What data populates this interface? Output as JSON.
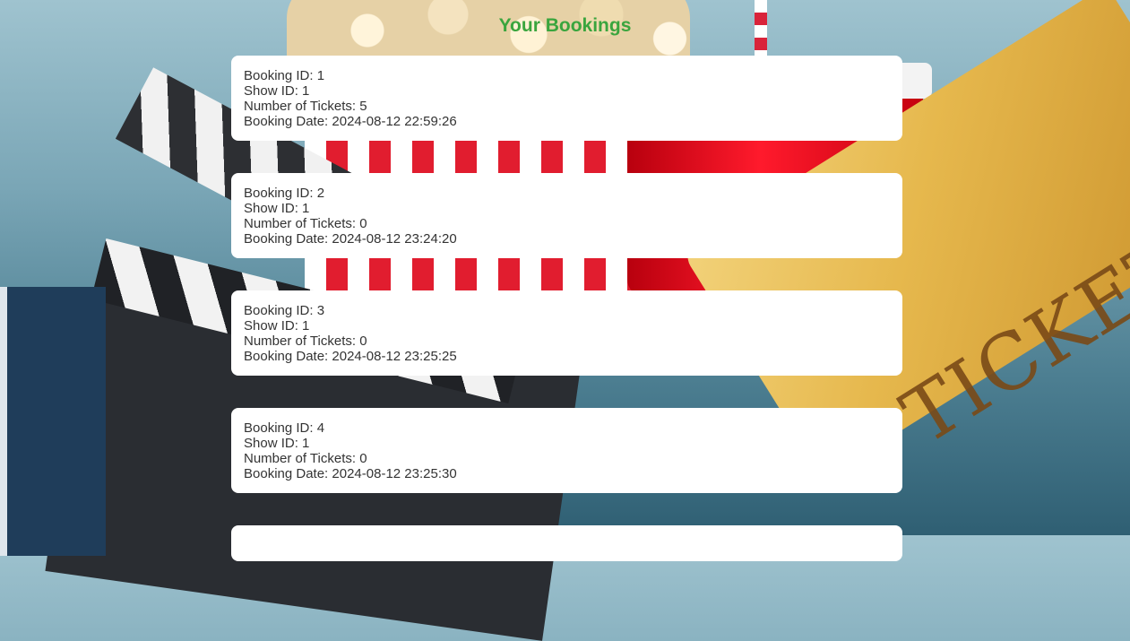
{
  "page": {
    "title": "Your Bookings",
    "accent_color": "#3aa53e"
  },
  "labels": {
    "booking_id": "Booking ID",
    "show_id": "Show ID",
    "tickets": "Number of Tickets",
    "date": "Booking Date"
  },
  "bookings": [
    {
      "booking_id_line": "Booking ID: 1",
      "show_id_line": "Show ID: 1",
      "tickets_line": "Number of Tickets: 5",
      "date_line": "Booking Date: 2024-08-12 22:59:26"
    },
    {
      "booking_id_line": "Booking ID: 2",
      "show_id_line": "Show ID: 1",
      "tickets_line": "Number of Tickets: 0",
      "date_line": "Booking Date: 2024-08-12 23:24:20"
    },
    {
      "booking_id_line": "Booking ID: 3",
      "show_id_line": "Show ID: 1",
      "tickets_line": "Number of Tickets: 0",
      "date_line": "Booking Date: 2024-08-12 23:25:25"
    },
    {
      "booking_id_line": "Booking ID: 4",
      "show_id_line": "Show ID: 1",
      "tickets_line": "Number of Tickets: 0",
      "date_line": "Booking Date: 2024-08-12 23:25:30"
    }
  ],
  "background": {
    "ticket_text": "TICKET"
  }
}
